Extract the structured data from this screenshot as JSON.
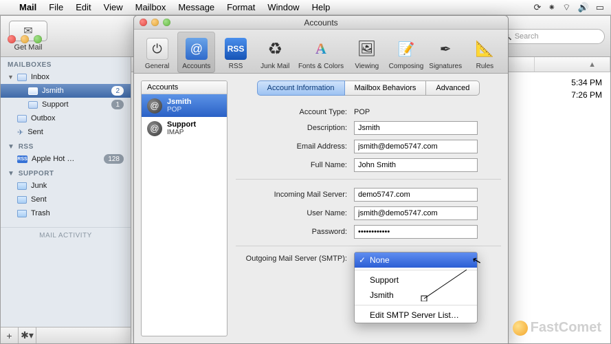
{
  "menubar": {
    "app": "Mail",
    "items": [
      "File",
      "Edit",
      "View",
      "Mailbox",
      "Message",
      "Format",
      "Window",
      "Help"
    ]
  },
  "main_toolbar": {
    "get_mail": "Get Mail",
    "search_placeholder": "Search"
  },
  "sidebar": {
    "sections": [
      {
        "name": "MAILBOXES",
        "items": [
          {
            "label": "Inbox",
            "expandable": true,
            "children": [
              {
                "label": "Jsmith",
                "badge": "2",
                "selected": true
              },
              {
                "label": "Support",
                "badge": "1"
              }
            ]
          },
          {
            "label": "Outbox"
          },
          {
            "label": "Sent"
          }
        ]
      },
      {
        "name": "RSS",
        "items": [
          {
            "label": "Apple Hot …",
            "badge": "128",
            "rss": true
          }
        ]
      },
      {
        "name": "SUPPORT",
        "items": [
          {
            "label": "Junk"
          },
          {
            "label": "Sent"
          },
          {
            "label": "Trash"
          }
        ]
      }
    ],
    "activity_label": "MAIL ACTIVITY"
  },
  "content": {
    "times": [
      "5:34 PM",
      "7:26 PM"
    ]
  },
  "prefs": {
    "title": "Accounts",
    "toolbar": [
      "General",
      "Accounts",
      "RSS",
      "Junk Mail",
      "Fonts & Colors",
      "Viewing",
      "Composing",
      "Signatures",
      "Rules"
    ],
    "toolbar_selected": 1,
    "accounts_header": "Accounts",
    "accounts": [
      {
        "name": "Jsmith",
        "type": "POP",
        "selected": true
      },
      {
        "name": "Support",
        "type": "IMAP"
      }
    ],
    "tabs": [
      "Account Information",
      "Mailbox Behaviors",
      "Advanced"
    ],
    "tab_selected": 0,
    "fields": {
      "account_type_label": "Account Type:",
      "account_type_value": "POP",
      "description_label": "Description:",
      "description_value": "Jsmith",
      "email_label": "Email Address:",
      "email_value": "jsmith@demo5747.com",
      "fullname_label": "Full Name:",
      "fullname_value": "John Smith",
      "incoming_label": "Incoming Mail Server:",
      "incoming_value": "demo5747.com",
      "username_label": "User Name:",
      "username_value": "jsmith@demo5747.com",
      "password_label": "Password:",
      "password_value": "••••••••••••",
      "smtp_label": "Outgoing Mail Server (SMTP):"
    },
    "smtp_menu": {
      "selected": "None",
      "options": [
        "Support",
        "Jsmith"
      ],
      "edit_label": "Edit SMTP Server List…"
    }
  },
  "watermark": "FastComet"
}
